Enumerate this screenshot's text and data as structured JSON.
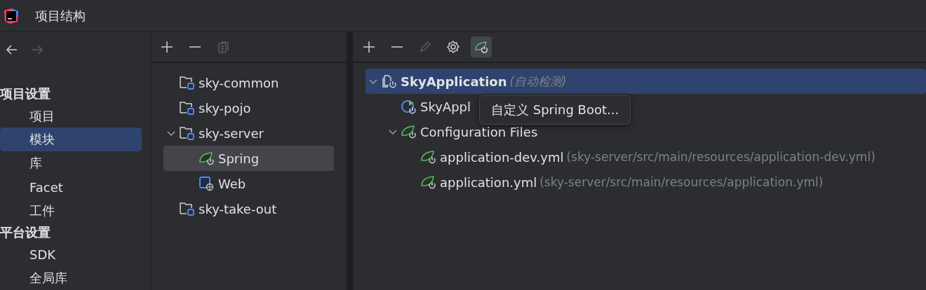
{
  "window": {
    "title": "项目结构"
  },
  "nav": [
    {
      "kind": "back",
      "disabled": false
    },
    {
      "kind": "forward",
      "disabled": true
    }
  ],
  "sidebar": {
    "sections": [
      {
        "title": "项目设置",
        "items": [
          {
            "label": "项目",
            "selected": false
          },
          {
            "label": "模块",
            "selected": true
          },
          {
            "label": "库",
            "selected": false
          },
          {
            "label": "Facet",
            "selected": false
          },
          {
            "label": "工件",
            "selected": false
          }
        ]
      },
      {
        "title": "平台设置",
        "items": [
          {
            "label": "SDK",
            "selected": false
          },
          {
            "label": "全局库",
            "selected": false
          }
        ]
      }
    ]
  },
  "modules": {
    "toolbar": [
      {
        "kind": "add",
        "disabled": false
      },
      {
        "kind": "remove",
        "disabled": false
      },
      {
        "kind": "copy",
        "disabled": true
      }
    ],
    "tree": [
      {
        "label": "sky-common",
        "kind": "module",
        "selected": false
      },
      {
        "label": "sky-pojo",
        "kind": "module",
        "selected": false
      },
      {
        "label": "sky-server",
        "kind": "module",
        "selected": false,
        "expanded": true,
        "children": [
          {
            "label": "Spring",
            "kind": "spring",
            "selected": true
          },
          {
            "label": "Web",
            "kind": "web",
            "selected": false
          }
        ]
      },
      {
        "label": "sky-take-out",
        "kind": "module",
        "selected": false
      }
    ]
  },
  "details": {
    "toolbar": [
      {
        "kind": "add",
        "disabled": false,
        "selected": false
      },
      {
        "kind": "remove",
        "disabled": false,
        "selected": false
      },
      {
        "kind": "edit",
        "disabled": true,
        "selected": false
      },
      {
        "kind": "settings",
        "disabled": false,
        "selected": false
      },
      {
        "kind": "spring",
        "disabled": false,
        "selected": true
      }
    ],
    "tree": [
      {
        "label": "SkyApplication",
        "hint": "(自动检测)",
        "kind": "context",
        "selected": true,
        "expanded": true,
        "children": [
          {
            "label": "SkyAppl",
            "kind": "run",
            "selected": false
          },
          {
            "label": "Configuration Files",
            "kind": "spring",
            "selected": false,
            "expanded": true,
            "children": [
              {
                "label": "application-dev.yml",
                "hint": "(sky-server/src/main/resources/application-dev.yml)",
                "kind": "spring",
                "selected": false
              },
              {
                "label": "application.yml",
                "hint": "(sky-server/src/main/resources/application.yml)",
                "kind": "spring",
                "selected": false
              }
            ]
          }
        ]
      }
    ]
  },
  "popup": {
    "label": "自定义 Spring Boot..."
  }
}
